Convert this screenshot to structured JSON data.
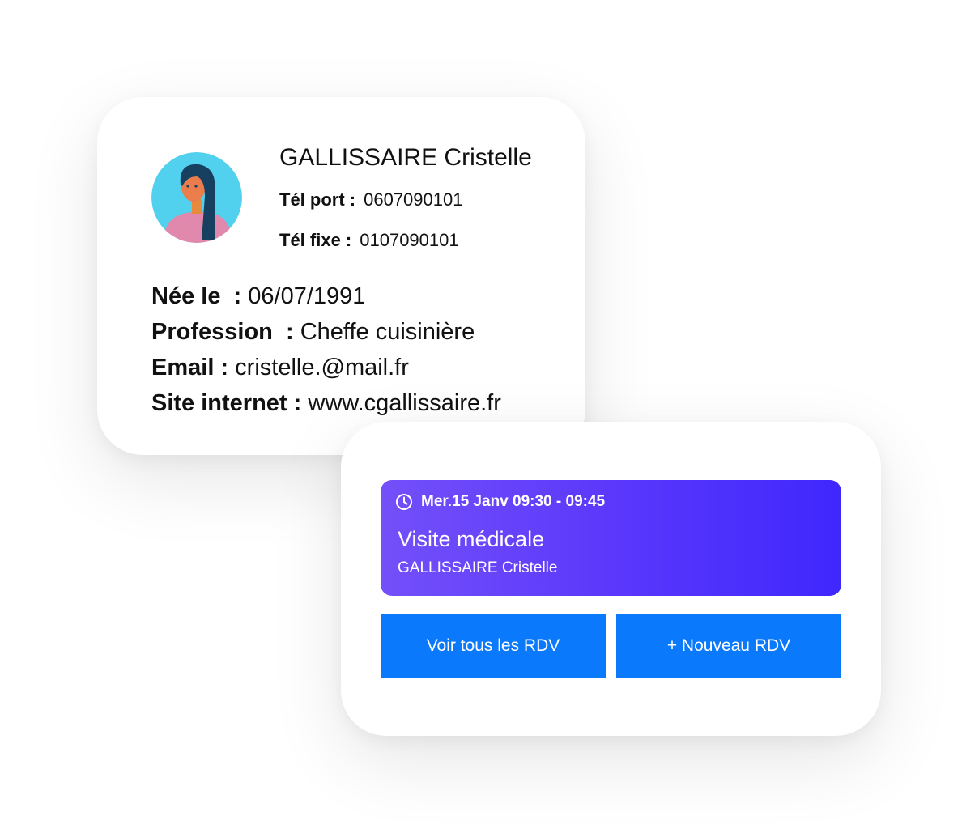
{
  "contact": {
    "avatar_icon": "woman-avatar-icon",
    "name": "GALLISSAIRE Cristelle",
    "tel_port_label": "Tél port :",
    "tel_port_value": "0607090101",
    "tel_fixe_label": "Tél fixe :",
    "tel_fixe_value": "0107090101",
    "birth_label": "Née le  :",
    "birth_value": "06/07/1991",
    "profession_label": "Profession  :",
    "profession_value": "Cheffe cuisinière",
    "email_label": "Email :",
    "email_value": "cristelle.@mail.fr",
    "site_label": "Site internet :",
    "site_value": "www.cgallissaire.fr"
  },
  "appointment": {
    "clock_icon": "clock-icon",
    "datetime": "Mer.15 Janv 09:30 - 09:45",
    "title": "Visite médicale",
    "patient": "GALLISSAIRE Cristelle",
    "gradient_start": "#7350f9",
    "gradient_end": "#3f28fd"
  },
  "actions": {
    "view_all_label": "Voir tous les RDV",
    "new_label": "+ Nouveau RDV",
    "button_color": "#0a79fb"
  }
}
